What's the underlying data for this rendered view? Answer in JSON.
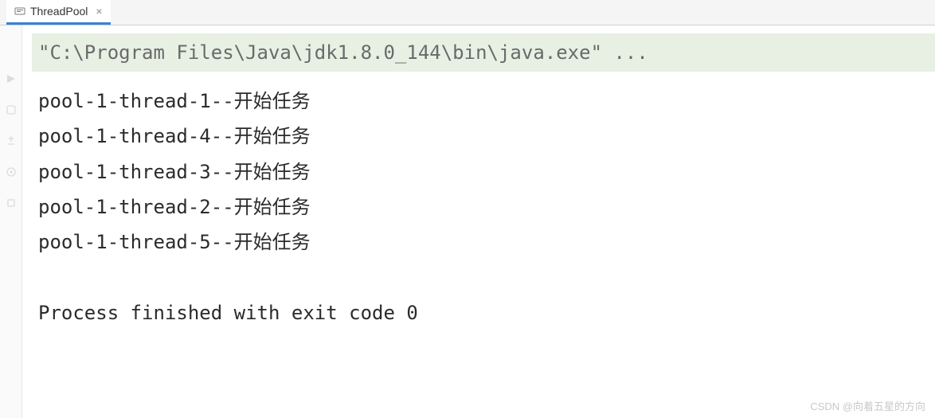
{
  "tab": {
    "title": "ThreadPool",
    "close_glyph": "×"
  },
  "console": {
    "command": "\"C:\\Program Files\\Java\\jdk1.8.0_144\\bin\\java.exe\" ...",
    "output_lines": [
      "pool-1-thread-1--开始任务",
      "pool-1-thread-4--开始任务",
      "pool-1-thread-3--开始任务",
      "pool-1-thread-2--开始任务",
      "pool-1-thread-5--开始任务"
    ],
    "process_message": "Process finished with exit code 0"
  },
  "watermark": "CSDN @向着五星的方向"
}
